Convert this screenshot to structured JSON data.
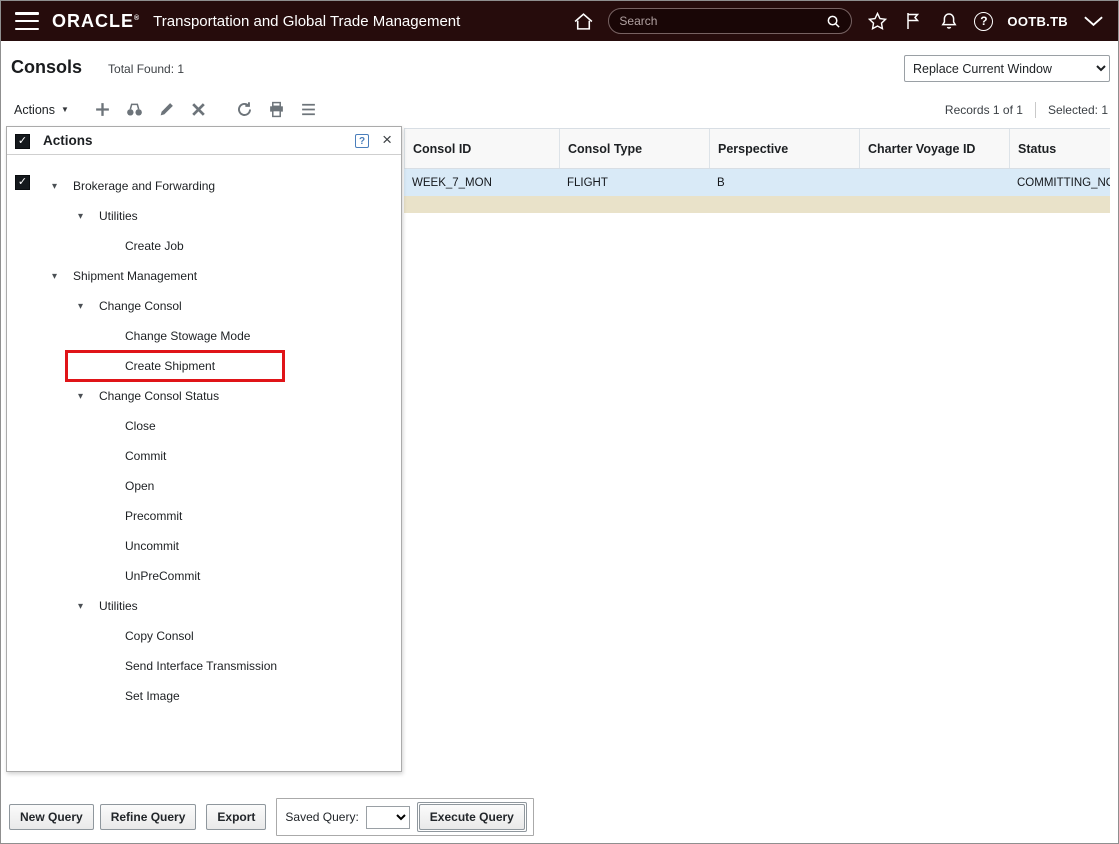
{
  "topbar": {
    "brand": "ORACLE",
    "brand_mark": "®",
    "app_title": "Transportation and Global Trade Management",
    "search_placeholder": "Search",
    "user_label": "OOTB.TB"
  },
  "header": {
    "title": "Consols",
    "total_found_label": "Total Found: 1",
    "window_mode_selected": "Replace Current Window"
  },
  "toolbar": {
    "actions_label": "Actions",
    "records_text": "Records 1 of 1",
    "selected_text": "Selected: 1"
  },
  "table": {
    "columns": [
      "Consol ID",
      "Consol Type",
      "Perspective",
      "Charter Voyage ID",
      "Status"
    ],
    "rows": [
      [
        "WEEK_7_MON",
        "FLIGHT",
        "B",
        "",
        "COMMITTING_NO"
      ]
    ]
  },
  "actions_popup": {
    "title": "Actions",
    "tree": [
      {
        "label": "Brokerage and Forwarding",
        "level": 1,
        "expandable": true
      },
      {
        "label": "Utilities",
        "level": 2,
        "expandable": true
      },
      {
        "label": "Create Job",
        "level": 3
      },
      {
        "label": "Shipment Management",
        "level": 1,
        "expandable": true
      },
      {
        "label": "Change Consol",
        "level": 2,
        "expandable": true
      },
      {
        "label": "Change Stowage Mode",
        "level": 3
      },
      {
        "label": "Create Shipment",
        "level": 3,
        "highlighted": true
      },
      {
        "label": "Change Consol Status",
        "level": 2,
        "expandable": true
      },
      {
        "label": "Close",
        "level": 3
      },
      {
        "label": "Commit",
        "level": 3
      },
      {
        "label": "Open",
        "level": 3
      },
      {
        "label": "Precommit",
        "level": 3
      },
      {
        "label": "Uncommit",
        "level": 3
      },
      {
        "label": "UnPreCommit",
        "level": 3
      },
      {
        "label": "Utilities",
        "level": 2,
        "expandable": true
      },
      {
        "label": "Copy Consol",
        "level": 3
      },
      {
        "label": "Send Interface Transmission",
        "level": 3
      },
      {
        "label": "Set Image",
        "level": 3
      }
    ]
  },
  "footer": {
    "new_query": "New Query",
    "refine_query": "Refine Query",
    "export": "Export",
    "saved_query_label": "Saved Query:",
    "execute_query": "Execute Query"
  },
  "icons": {
    "twisty": "▾",
    "caret": "▼",
    "close": "×",
    "help": "?"
  },
  "colors": {
    "topbar_bg": "#260c0c",
    "selected_row_bg": "#d9eaf7",
    "summary_strip_bg": "#e9e2c9",
    "highlight_border": "#e01418"
  }
}
